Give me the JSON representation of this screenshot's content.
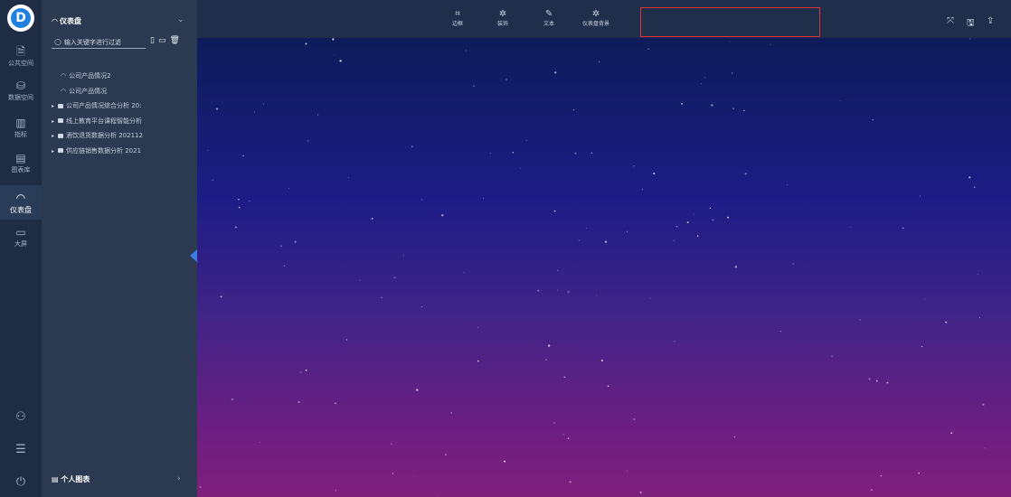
{
  "rail": {
    "items": [
      {
        "icon": "document-icon",
        "glyph": "🗎",
        "label": "公共空间"
      },
      {
        "icon": "database-icon",
        "glyph": "⛁",
        "label": "数据空间"
      },
      {
        "icon": "bar-chart-icon",
        "glyph": "▥",
        "label": "指标"
      },
      {
        "icon": "chart-library-icon",
        "glyph": "▤",
        "label": "图表库"
      },
      {
        "icon": "dashboard-icon",
        "glyph": "◠",
        "label": "仪表盘"
      },
      {
        "icon": "monitor-icon",
        "glyph": "▭",
        "label": "大屏"
      }
    ],
    "bottom": [
      {
        "icon": "user-icon",
        "glyph": "⚇"
      },
      {
        "icon": "settings-icon",
        "glyph": "☰"
      },
      {
        "icon": "power-icon",
        "glyph": "⏻"
      }
    ]
  },
  "panel": {
    "title": "仪表盘",
    "search_placeholder": "输入关键字进行过滤",
    "tree": [
      {
        "type": "dashboard",
        "label": "公司产品情况2"
      },
      {
        "type": "dashboard",
        "label": "公司产品情况"
      },
      {
        "type": "folder",
        "label": "公司产品情况综合分析 20:"
      },
      {
        "type": "folder",
        "label": "线上教育平台课程智能分析"
      },
      {
        "type": "folder",
        "label": "酒饮退货数据分析 202112"
      },
      {
        "type": "folder",
        "label": "供应链销售数据分析 2021"
      }
    ],
    "footer": "个人图表"
  },
  "toolbar": {
    "items": [
      {
        "icon": "crop-border-icon",
        "glyph": "⌗",
        "label": "边框"
      },
      {
        "icon": "decoration-icon",
        "glyph": "✲",
        "label": "装饰"
      },
      {
        "icon": "text-edit-icon",
        "glyph": "✎",
        "label": "文本"
      },
      {
        "icon": "background-icon",
        "glyph": "✲",
        "label": "仪表盘背景"
      }
    ],
    "highlight_color": "#e03232"
  },
  "right_actions": [
    {
      "icon": "fullscreen-icon",
      "glyph": "⤧"
    },
    {
      "icon": "save-icon",
      "glyph": "🖫"
    },
    {
      "icon": "share-export-icon",
      "glyph": "⇪"
    }
  ],
  "colors": {
    "rail_bg": "#1e2d43",
    "panel_bg": "#2b3a50",
    "topbar_bg": "#1f2e4a",
    "accent": "#3b7de0"
  }
}
